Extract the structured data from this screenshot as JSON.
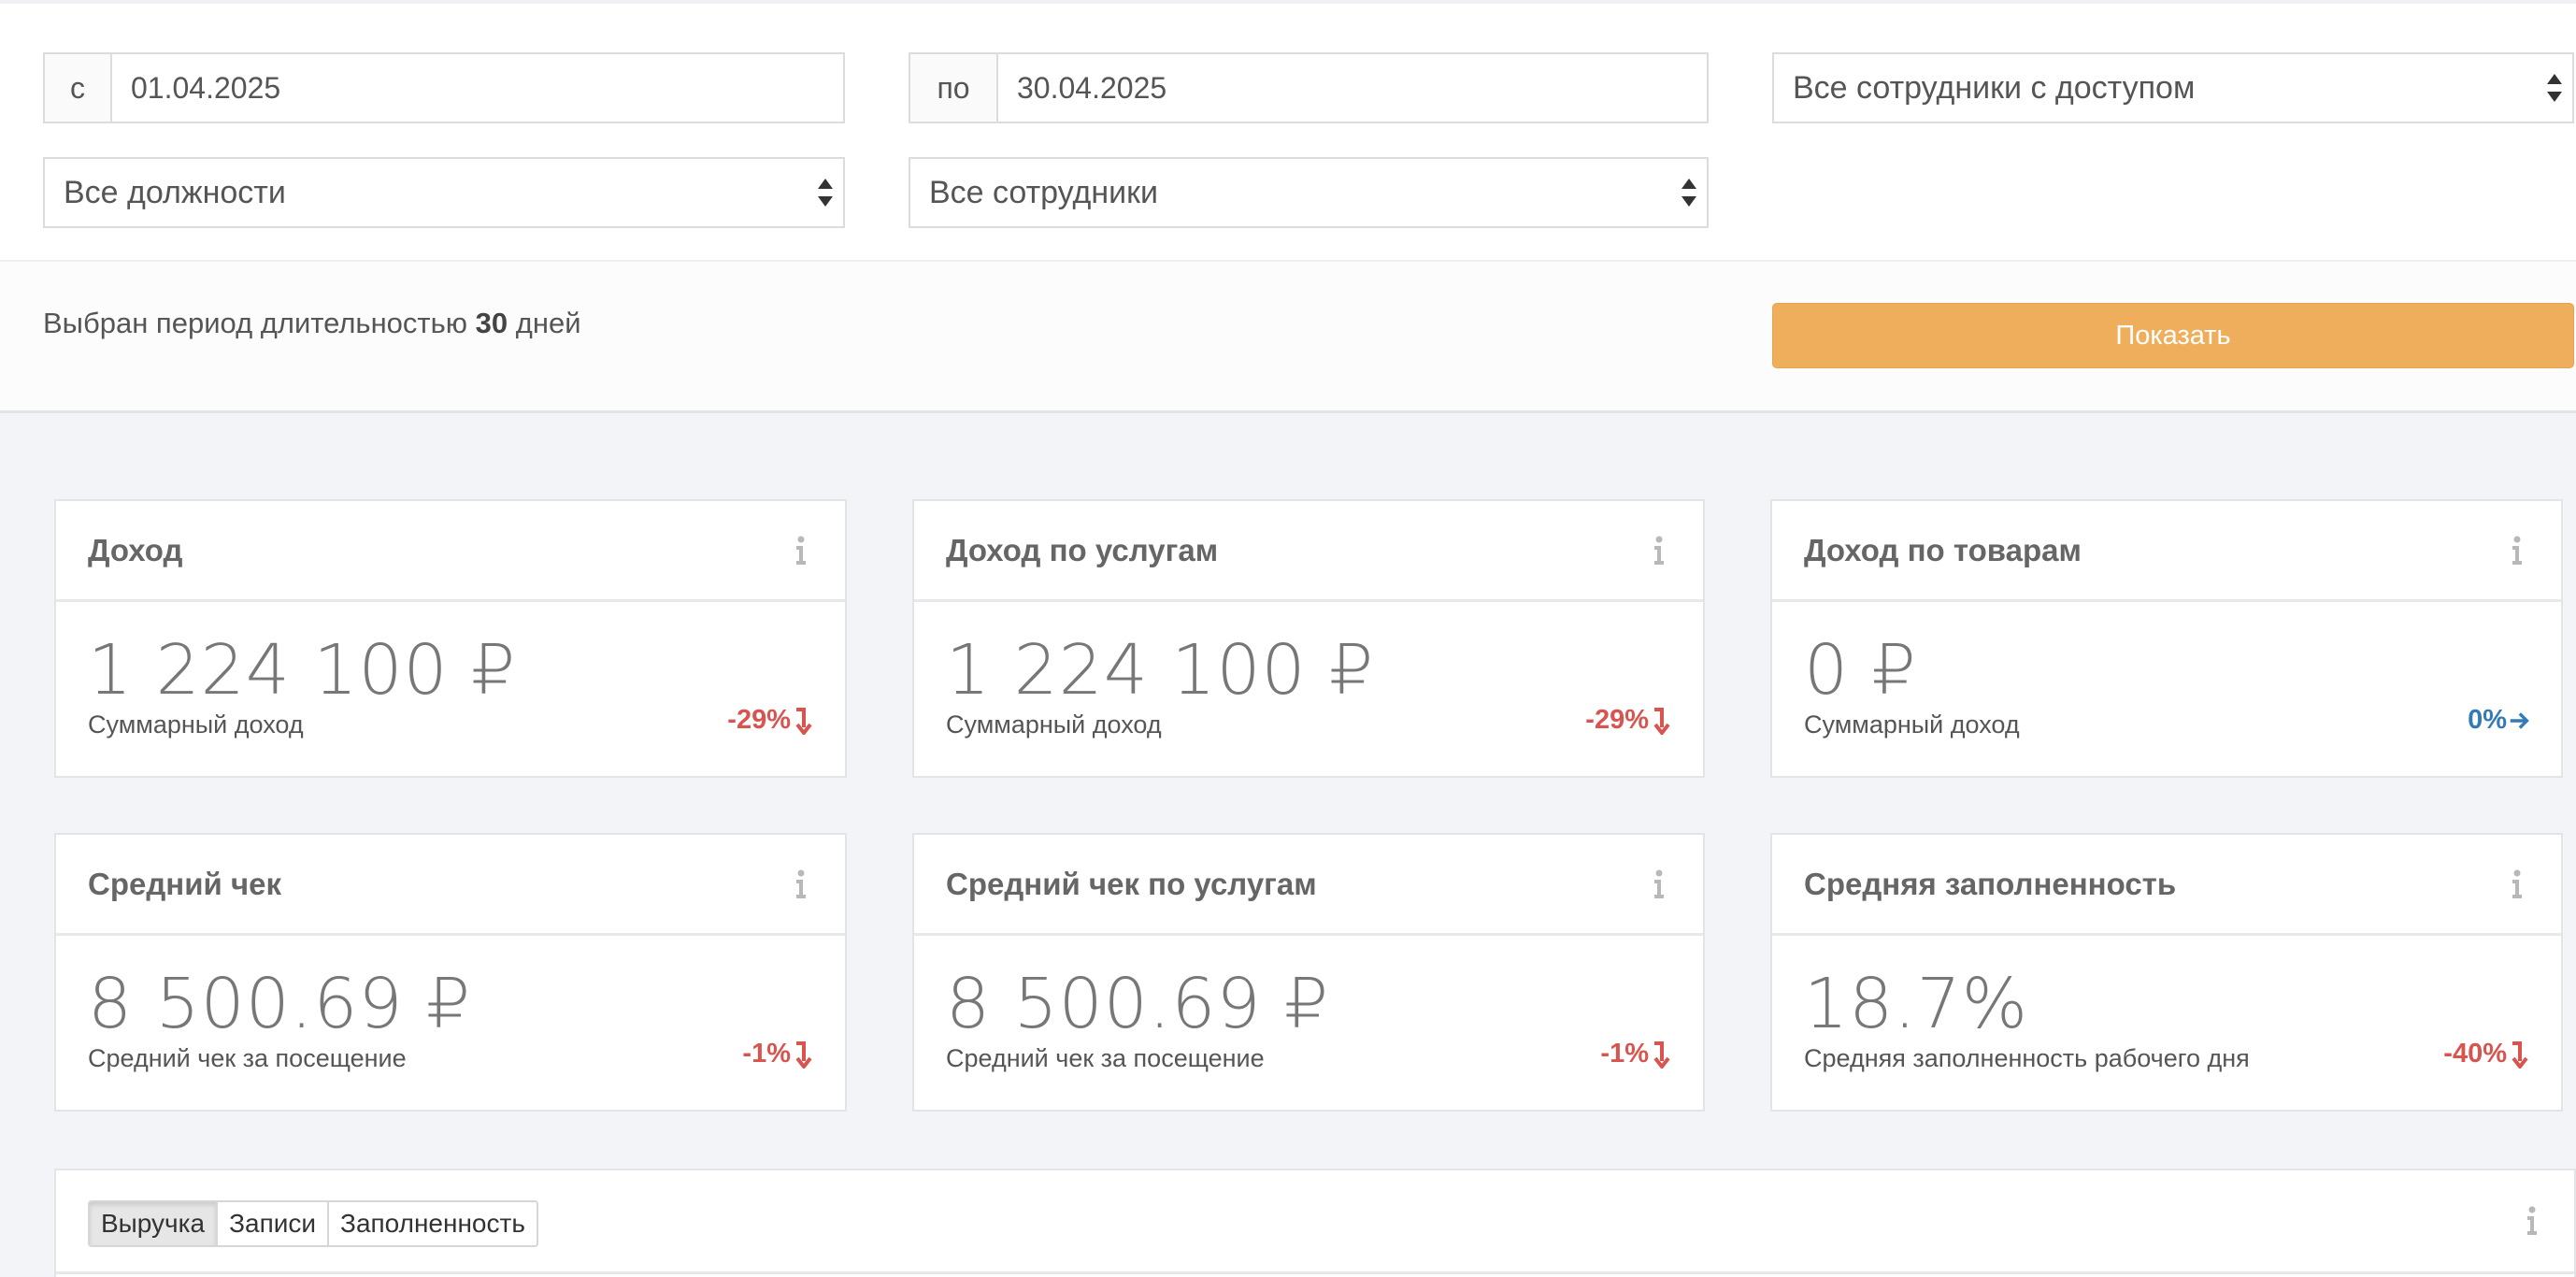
{
  "filters": {
    "date_from": {
      "prefix": "с",
      "value": "01.04.2025"
    },
    "date_to": {
      "prefix": "по",
      "value": "30.04.2025"
    },
    "access_select": "Все сотрудники с доступом",
    "position_select": "Все должности",
    "employee_select": "Все сотрудники"
  },
  "period": {
    "prefix": "Выбран период длительностью",
    "days": "30",
    "suffix": "дней"
  },
  "show_button": "Показать",
  "cards": [
    {
      "title": "Доход",
      "value": "1 224 100 ₽",
      "subtitle": "Суммарный доход",
      "delta": "-29%",
      "trend": "down",
      "color": "#d9534f"
    },
    {
      "title": "Доход по услугам",
      "value": "1 224 100 ₽",
      "subtitle": "Суммарный доход",
      "delta": "-29%",
      "trend": "down",
      "color": "#d9534f"
    },
    {
      "title": "Доход по товарам",
      "value": "0 ₽",
      "subtitle": "Суммарный доход",
      "delta": "0%",
      "trend": "flat",
      "color": "#337ab7"
    },
    {
      "title": "Средний чек",
      "value": "8 500.69 ₽",
      "subtitle": "Средний чек за посещение",
      "delta": "-1%",
      "trend": "down",
      "color": "#d9534f"
    },
    {
      "title": "Средний чек по услугам",
      "value": "8 500.69 ₽",
      "subtitle": "Средний чек за посещение",
      "delta": "-1%",
      "trend": "down",
      "color": "#d9534f"
    },
    {
      "title": "Средняя заполненность",
      "value": "18.7%",
      "subtitle": "Средняя заполненность рабочего дня",
      "delta": "-40%",
      "trend": "down",
      "color": "#d9534f"
    }
  ],
  "chart_tabs": {
    "items": [
      "Выручка",
      "Записи",
      "Заполненность"
    ],
    "active": "Выручка"
  },
  "colors": {
    "accent_button": "#efae5b",
    "negative": "#d9534f",
    "neutral": "#337ab7",
    "background": "#f3f4f8"
  },
  "icons": {
    "info": "info-icon",
    "down_arrow": "arrow-down-icon",
    "right_arrow": "arrow-right-icon",
    "select_arrows": "select-arrows-icon"
  }
}
